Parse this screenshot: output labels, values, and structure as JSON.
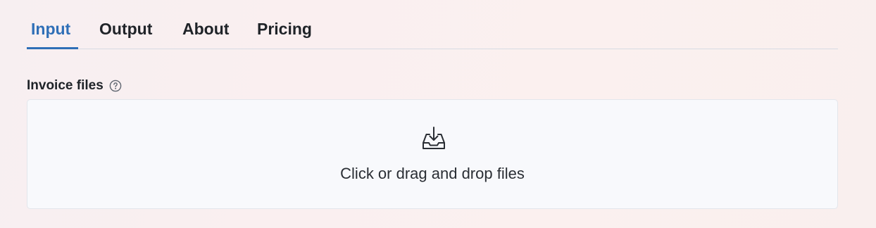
{
  "tabs": [
    {
      "label": "Input",
      "active": true
    },
    {
      "label": "Output",
      "active": false
    },
    {
      "label": "About",
      "active": false
    },
    {
      "label": "Pricing",
      "active": false
    }
  ],
  "field": {
    "label": "Invoice files",
    "help_icon": "question-circle-icon"
  },
  "dropzone": {
    "icon": "download-tray-icon",
    "text": "Click or drag and drop files"
  },
  "colors": {
    "accent": "#2f6fb7",
    "text": "#1f2328",
    "dropzone_bg": "#f8f9fc",
    "divider": "#d6dbe3"
  }
}
